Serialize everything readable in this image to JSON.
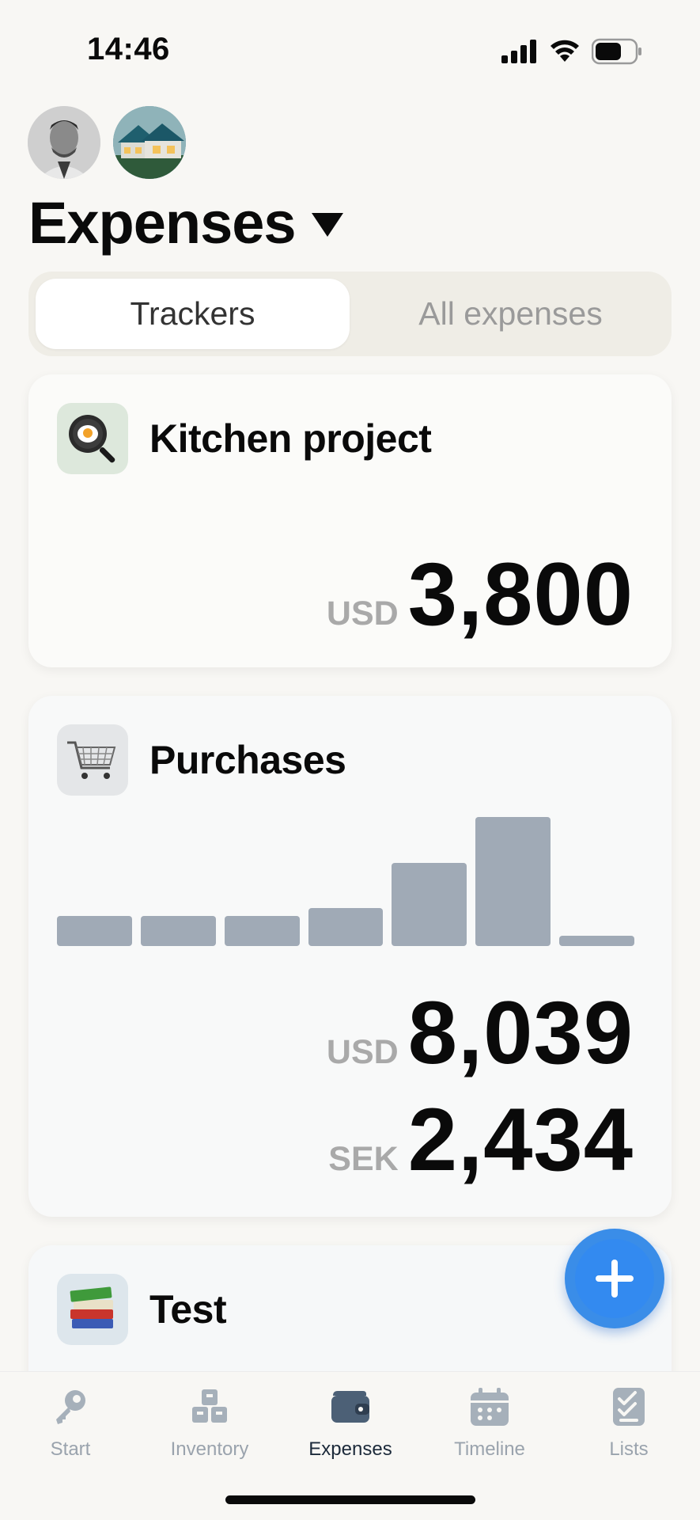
{
  "status_bar": {
    "time": "14:46"
  },
  "header": {
    "title": "Expenses"
  },
  "segmented": {
    "active": "Trackers",
    "inactive": "All expenses"
  },
  "trackers": [
    {
      "title": "Kitchen project",
      "icon": "frying-pan-icon",
      "amounts": [
        {
          "currency": "USD",
          "value": "3,800"
        }
      ]
    },
    {
      "title": "Purchases",
      "icon": "shopping-cart-icon",
      "amounts": [
        {
          "currency": "USD",
          "value": "8,039"
        },
        {
          "currency": "SEK",
          "value": "2,434"
        }
      ]
    },
    {
      "title": "Test",
      "icon": "books-icon"
    }
  ],
  "purchases_chart_levels": [
    0.23,
    0.23,
    0.23,
    0.29,
    0.63,
    0.98,
    0.08
  ],
  "fab": {
    "icon": "plus-icon"
  },
  "tabbar": {
    "items": [
      {
        "label": "Start",
        "icon": "key-icon"
      },
      {
        "label": "Inventory",
        "icon": "boxes-icon"
      },
      {
        "label": "Expenses",
        "icon": "wallet-icon"
      },
      {
        "label": "Timeline",
        "icon": "calendar-icon"
      },
      {
        "label": "Lists",
        "icon": "checklist-icon"
      }
    ],
    "active": "Expenses"
  },
  "colors": {
    "accent": "#3a8de8",
    "bar": "#a0aab6",
    "inactive_tab": "#9aa3ad"
  }
}
